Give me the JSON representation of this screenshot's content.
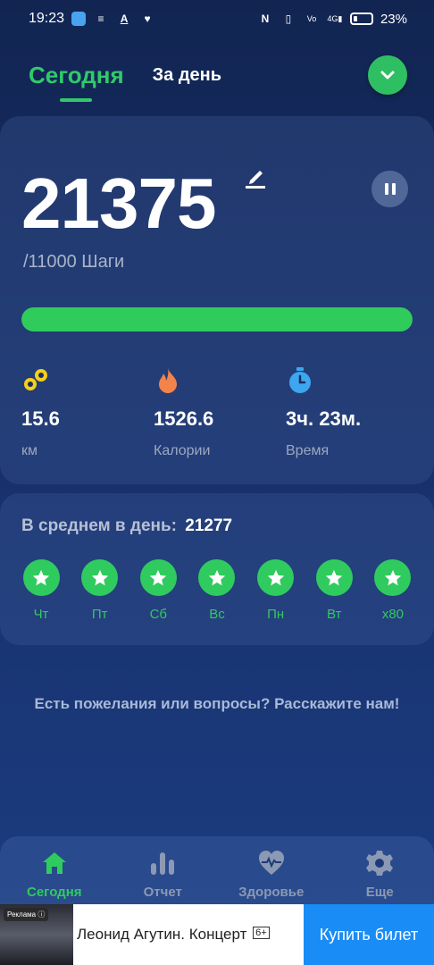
{
  "status_bar": {
    "time": "19:23",
    "battery_percent": "23%",
    "icons": [
      "app-icon",
      "menu-lines-icon",
      "text-a-icon",
      "heart-icon",
      "nfc-icon",
      "vibrate-icon",
      "volte-icon",
      "signal-4g-icon",
      "battery-icon"
    ]
  },
  "tabs": {
    "today": "Сегодня",
    "day": "За день"
  },
  "steps": {
    "count": "21375",
    "goal": "/11000 Шаги",
    "progress_fraction": 1.0
  },
  "metrics": {
    "distance": {
      "value": "15.6",
      "label": "км",
      "icon": "distance-icon",
      "color": "#f5cf1a"
    },
    "calories": {
      "value": "1526.6",
      "label": "Калории",
      "icon": "flame-icon",
      "color": "#f4834a"
    },
    "time": {
      "value": "3ч. 23м.",
      "label": "Время",
      "icon": "stopwatch-icon",
      "color": "#3da6ee"
    }
  },
  "average": {
    "title": "В среднем в день:",
    "value": "21277",
    "days": [
      "Чт",
      "Пт",
      "Сб",
      "Вс",
      "Пн",
      "Вт",
      "x80"
    ]
  },
  "feedback_text": "Есть пожелания или вопросы? Расскажите нам!",
  "nav": {
    "today": "Сегодня",
    "report": "Отчет",
    "health": "Здоровье",
    "more": "Еще"
  },
  "ad": {
    "badge": "Реклама ⓘ",
    "text": "Леонид Агутин. Концерт",
    "age": "6+",
    "button": "Купить билет"
  },
  "colors": {
    "accent": "#31c96a",
    "bg_top": "#122552",
    "bg_bottom": "#1c3d82"
  }
}
